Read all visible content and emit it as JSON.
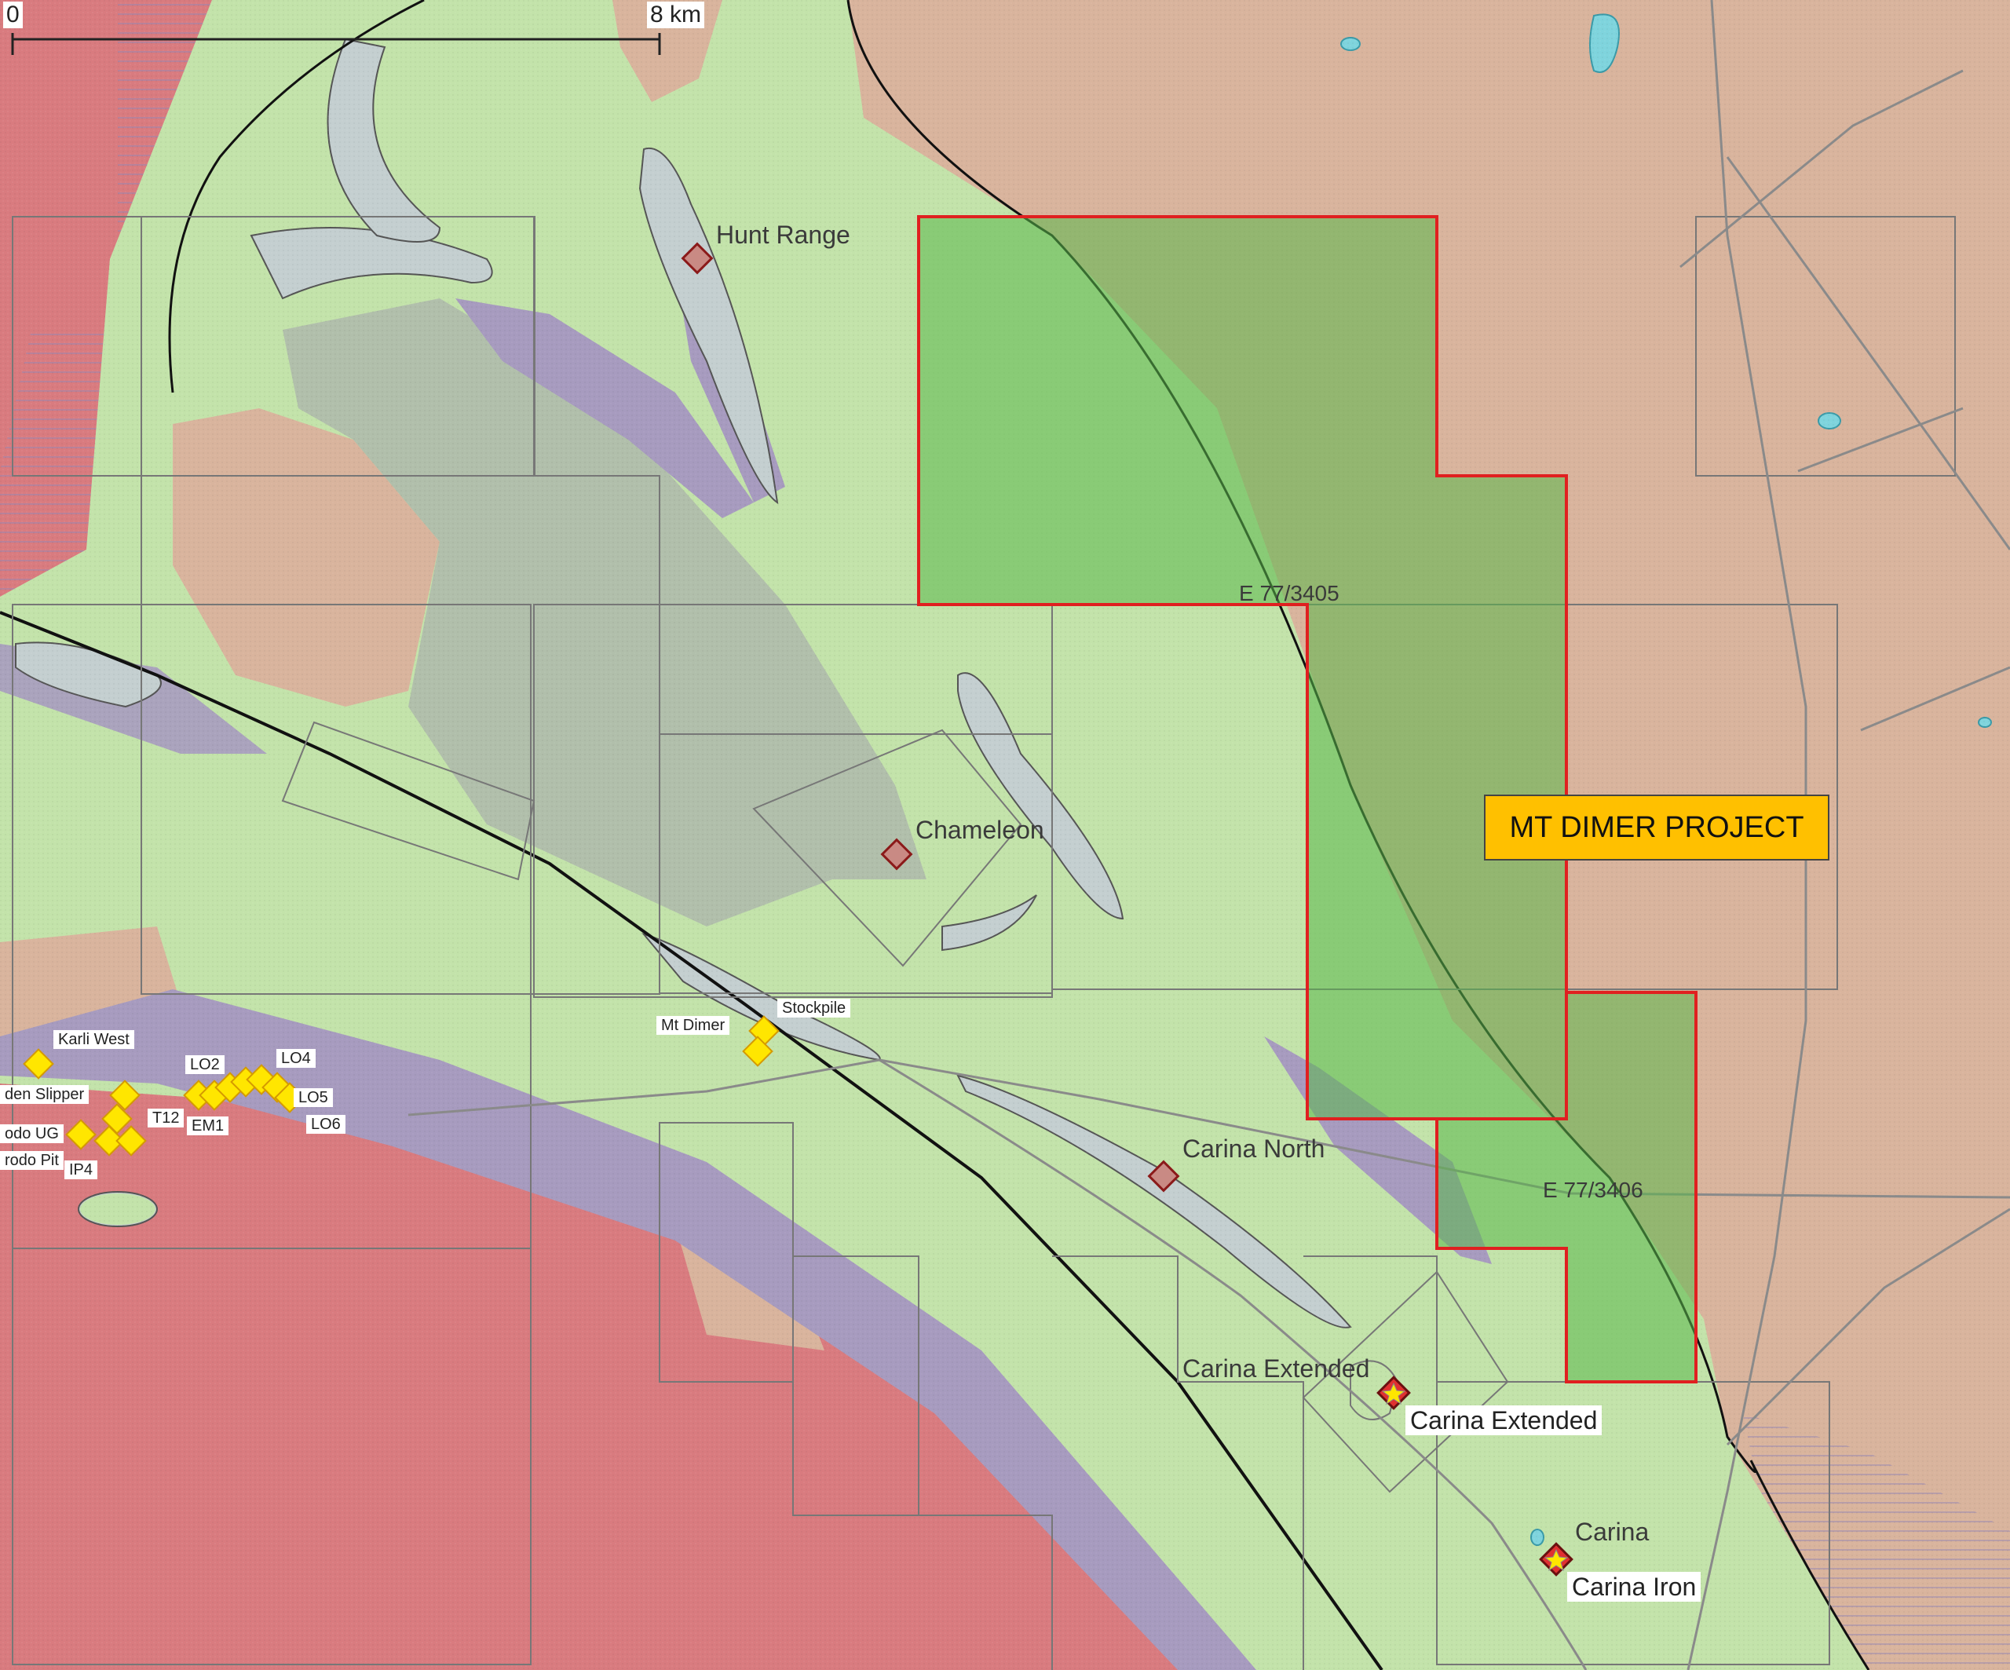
{
  "scale_bar": {
    "start": "0",
    "end": "8 km"
  },
  "project_label": "MT DIMER PROJECT",
  "tenements": [
    {
      "id": "E 77/3405"
    },
    {
      "id": "E 77/3406"
    }
  ],
  "prospects": {
    "hunt_range": "Hunt Range",
    "chameleon": "Chameleon",
    "carina_north": "Carina North",
    "carina_extended_plain": "Carina Extended",
    "carina_plain": "Carina"
  },
  "deposits": {
    "carina_extended": "Carina Extended",
    "carina_iron": "Carina Iron"
  },
  "mine_points": {
    "karli_west": "Karli West",
    "golden_slipper": "den Slipper",
    "dodo_ug": "odo UG",
    "dodo_pit": "rodo Pit",
    "ip4": "IP4",
    "t12": "T12",
    "em1": "EM1",
    "lo2": "LO2",
    "lo4": "LO4",
    "lo5": "LO5",
    "lo6": "LO6",
    "mt_dimer": "Mt Dimer",
    "stockpile": "Stockpile"
  },
  "colors": {
    "granite": "#d97b7f",
    "greenstone": "#c3e3aa",
    "regolith": "#d9b49d",
    "ultramafic": "#a79bbf",
    "bif": "#c4cfd0",
    "tenement_fill": "#5ab84b",
    "tenement_border": "#e02020",
    "mine_marker": "#ffe600",
    "label_box": "#ffc000"
  },
  "icons": {
    "prospect": "diamond-outline-icon",
    "deposit": "star-icon",
    "mine": "diamond-filled-icon"
  }
}
